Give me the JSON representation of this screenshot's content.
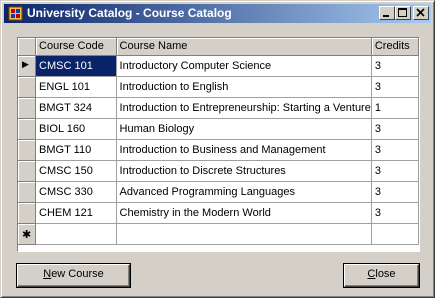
{
  "window": {
    "title": "University Catalog - Course Catalog"
  },
  "grid": {
    "columns": [
      "Course Code",
      "Course Name",
      "Credits"
    ],
    "rows": [
      [
        "CMSC 101",
        "Introductory Computer Science",
        "3"
      ],
      [
        "ENGL 101",
        "Introduction to English",
        "3"
      ],
      [
        "BMGT 324",
        "Introduction to Entrepreneurship: Starting a Venture",
        "1"
      ],
      [
        "BIOL 160",
        "Human Biology",
        "3"
      ],
      [
        "BMGT 110",
        "Introduction to Business and Management",
        "3"
      ],
      [
        "CMSC 150",
        "Introduction to Discrete Structures",
        "3"
      ],
      [
        "CMSC 330",
        "Advanced Programming Languages",
        "3"
      ],
      [
        "CHEM 121",
        "Chemistry in the Modern World",
        "3"
      ]
    ],
    "current_row_marker": "▶",
    "new_row_marker": "✱"
  },
  "buttons": {
    "new_course": {
      "mnemonic": "N",
      "rest": "ew Course"
    },
    "close": {
      "mnemonic": "C",
      "rest": "lose"
    }
  },
  "icons": [
    "app-icon",
    "minimize-icon",
    "maximize-icon",
    "close-icon",
    "current-row-arrow-icon",
    "new-row-star-icon"
  ]
}
